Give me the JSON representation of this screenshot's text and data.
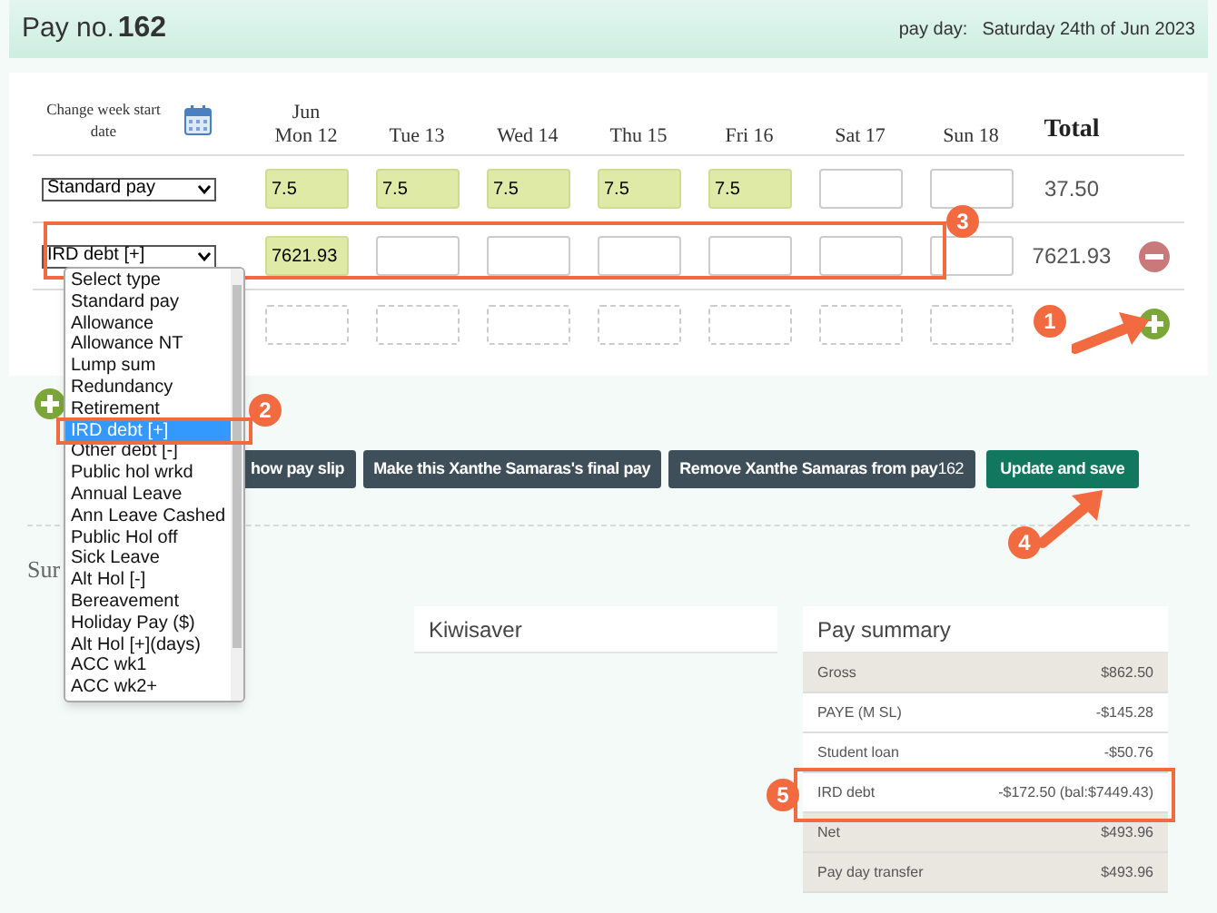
{
  "header": {
    "title": "Pay no.",
    "number": "162",
    "pay_day_label": "pay day:",
    "pay_day": "Saturday 24th of Jun 2023"
  },
  "week_start_label": "Change week start date",
  "days": [
    {
      "month": "Jun",
      "label": "Mon 12"
    },
    {
      "label": "Tue 13"
    },
    {
      "label": "Wed 14"
    },
    {
      "label": "Thu 15"
    },
    {
      "label": "Fri 16"
    },
    {
      "label": "Sat 17"
    },
    {
      "label": "Sun 18"
    }
  ],
  "total_header": "Total",
  "rows": [
    {
      "kind": "entry",
      "type": "Standard pay",
      "cells": [
        {
          "value": "7.5",
          "filled": true
        },
        {
          "value": "7.5",
          "filled": true
        },
        {
          "value": "7.5",
          "filled": true
        },
        {
          "value": "7.5",
          "filled": true
        },
        {
          "value": "7.5",
          "filled": true
        },
        {
          "filled": false
        },
        {
          "filled": false
        }
      ],
      "total": "37.50",
      "removable": false
    },
    {
      "kind": "entry",
      "type": "IRD debt [+]",
      "cells": [
        {
          "value": "7621.93",
          "filled": true
        },
        {
          "filled": false
        },
        {
          "filled": false
        },
        {
          "filled": false
        },
        {
          "filled": false
        },
        {
          "filled": false
        },
        {
          "filled": false
        }
      ],
      "total": "7621.93",
      "removable": true
    },
    {
      "kind": "new",
      "cells": [
        {
          "filled": false
        },
        {
          "filled": false
        },
        {
          "filled": false
        },
        {
          "filled": false
        },
        {
          "filled": false
        },
        {
          "filled": false
        },
        {
          "filled": false
        }
      ],
      "addable": true
    }
  ],
  "dropdown": {
    "options": [
      {
        "label": "Select type",
        "selected": false
      },
      {
        "label": "Standard pay",
        "selected": false
      },
      {
        "label": "Allowance",
        "selected": false
      },
      {
        "label": "Allowance NT",
        "selected": false
      },
      {
        "label": "Lump sum",
        "selected": false
      },
      {
        "label": "Redundancy",
        "selected": false
      },
      {
        "label": "Retirement",
        "selected": false
      },
      {
        "label": "IRD debt [+]",
        "selected": true
      },
      {
        "label": "Other debt [-]",
        "selected": false
      },
      {
        "label": "Public hol wrkd",
        "selected": false
      },
      {
        "label": "Annual Leave",
        "selected": false
      },
      {
        "label": "Ann Leave Cashed",
        "selected": false
      },
      {
        "label": "Public Hol off",
        "selected": false
      },
      {
        "label": "Sick Leave",
        "selected": false
      },
      {
        "label": "Alt Hol [-]",
        "selected": false
      },
      {
        "label": "Bereavement",
        "selected": false
      },
      {
        "label": "Holiday Pay ($)",
        "selected": false
      },
      {
        "label": "Alt Hol [+](days)",
        "selected": false
      },
      {
        "label": "ACC wk1",
        "selected": false
      },
      {
        "label": "ACC wk2+",
        "selected": false
      }
    ]
  },
  "buttons": [
    {
      "kind": "dark",
      "label": "how pay slip"
    },
    {
      "kind": "dark",
      "label": "Make this Xanthe Samaras's final pay"
    },
    {
      "kind": "dark",
      "label": "Remove Xanthe Samaras from pay",
      "number": "162"
    },
    {
      "kind": "primary",
      "label": "Update and save"
    }
  ],
  "summary_heading": "Sur",
  "kiwisaver": {
    "title": "Kiwisaver"
  },
  "pay_summary": {
    "title": "Pay summary",
    "rows": [
      {
        "label": "Gross",
        "value": "$862.50",
        "shaded": true
      },
      {
        "label": "PAYE (M SL)",
        "value": "-$145.28",
        "shaded": false
      },
      {
        "label": "Student loan",
        "value": "-$50.76",
        "shaded": false
      },
      {
        "label": "IRD debt",
        "value": "-$172.50 (bal:$7449.43)",
        "shaded": false
      },
      {
        "label": "Net",
        "value": "$493.96",
        "shaded": true
      },
      {
        "label": "Pay day transfer",
        "value": "$493.96",
        "shaded": true
      }
    ]
  },
  "annotations": [
    {
      "number": "1"
    },
    {
      "number": "2"
    },
    {
      "number": "3"
    },
    {
      "number": "4"
    },
    {
      "number": "5"
    }
  ]
}
